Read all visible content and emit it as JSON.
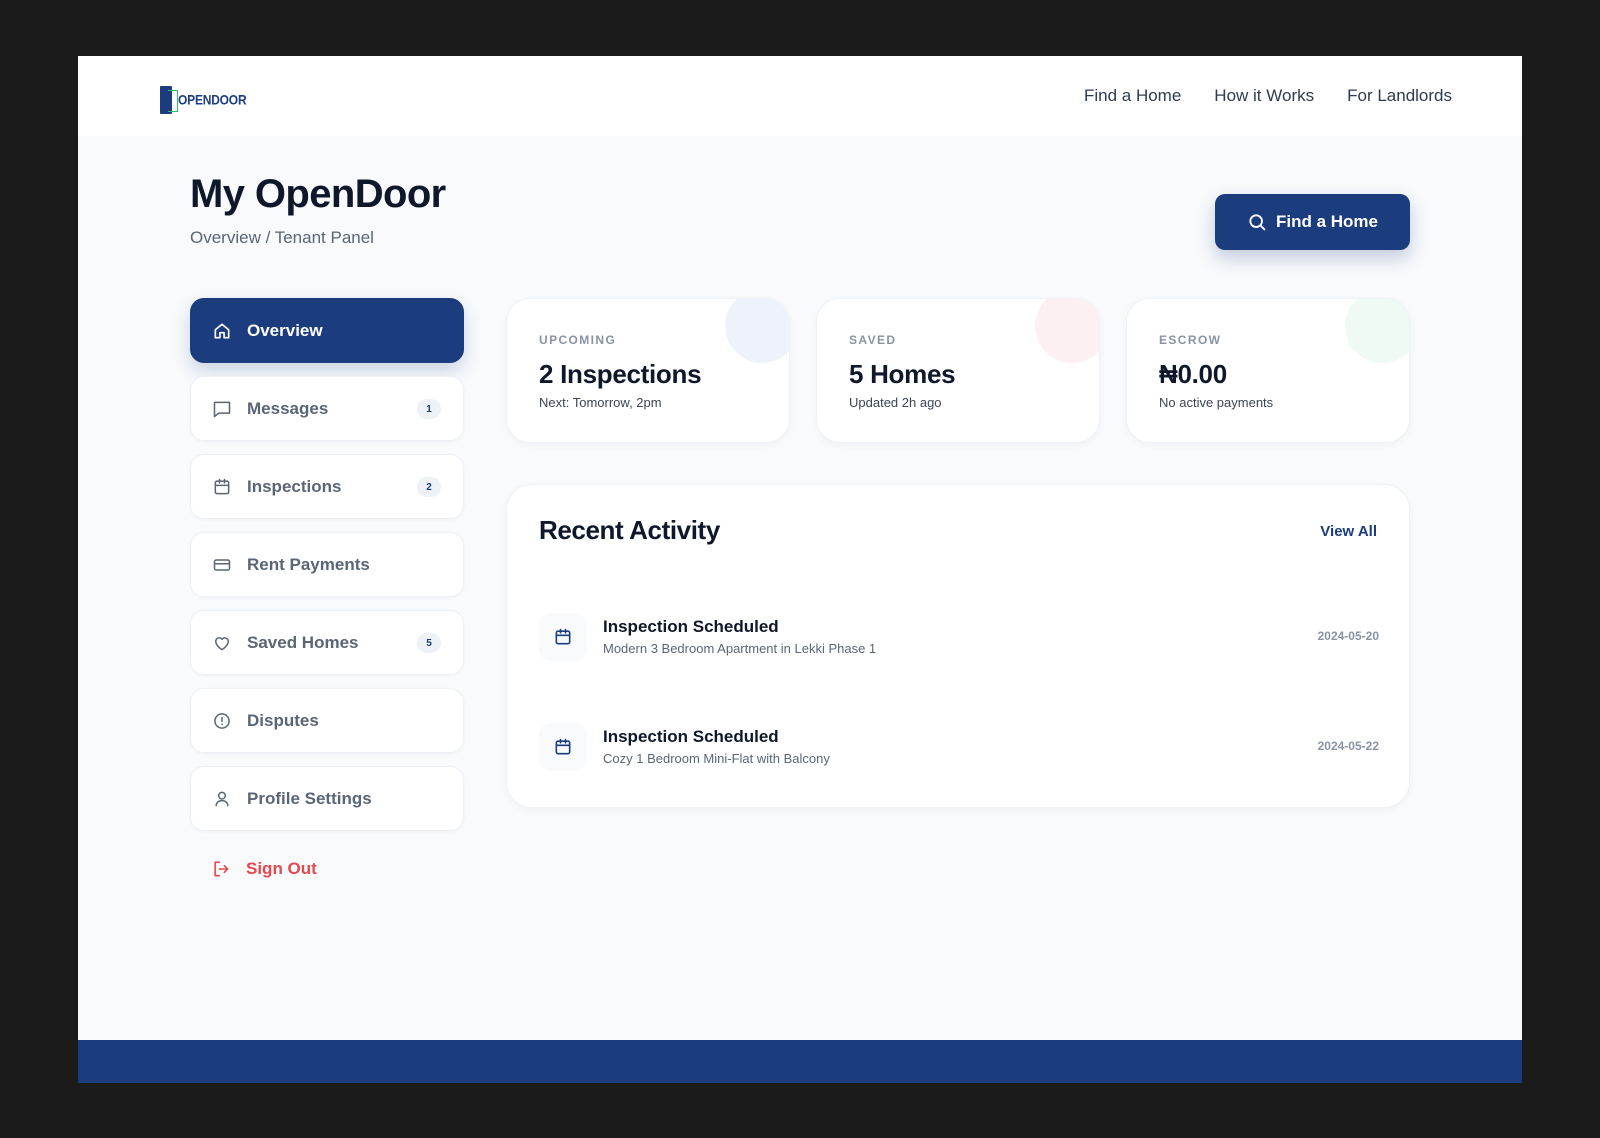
{
  "brand": {
    "logo_text": "OPENDOOR",
    "primary_color": "#1b3c7d",
    "accent_color": "#22c55e",
    "danger_color": "#e5484d"
  },
  "nav": {
    "links": [
      "Find a Home",
      "How it Works",
      "For Landlords"
    ]
  },
  "header": {
    "title": "My OpenDoor",
    "breadcrumb": "Overview / Tenant Panel",
    "cta_label": "Find a Home",
    "cta_icon": "search-icon"
  },
  "sidebar": {
    "items": [
      {
        "label": "Overview",
        "icon": "home-icon",
        "active": true
      },
      {
        "label": "Messages",
        "icon": "message-icon",
        "badge": "1"
      },
      {
        "label": "Inspections",
        "icon": "calendar-icon",
        "badge": "2"
      },
      {
        "label": "Rent Payments",
        "icon": "credit-card-icon"
      },
      {
        "label": "Saved Homes",
        "icon": "heart-icon",
        "badge": "5"
      },
      {
        "label": "Disputes",
        "icon": "alert-circle-icon"
      },
      {
        "label": "Profile Settings",
        "icon": "user-icon"
      }
    ],
    "signout_label": "Sign Out"
  },
  "stats": [
    {
      "label": "UPCOMING",
      "value": "2 Inspections",
      "sub": "Next: Tomorrow, 2pm"
    },
    {
      "label": "SAVED",
      "value": "5 Homes",
      "sub": "Updated 2h ago"
    },
    {
      "label": "ESCROW",
      "value": "₦0.00",
      "sub": "No active payments"
    }
  ],
  "activity": {
    "title": "Recent Activity",
    "view_all": "View All",
    "items": [
      {
        "title": "Inspection Scheduled",
        "sub": "Modern 3 Bedroom Apartment in Lekki Phase 1",
        "date": "2024-05-20",
        "icon": "calendar-icon"
      },
      {
        "title": "Inspection Scheduled",
        "sub": "Cozy 1 Bedroom Mini-Flat with Balcony",
        "date": "2024-05-22",
        "icon": "calendar-icon"
      }
    ]
  }
}
